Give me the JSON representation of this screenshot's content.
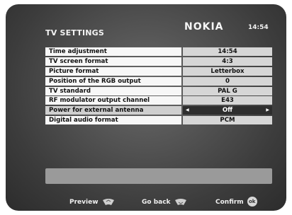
{
  "header": {
    "title": "TV SETTINGS",
    "brand": "NOKIA",
    "time": "14:54"
  },
  "settings": [
    {
      "label": "Time adjustment",
      "value": "14:54"
    },
    {
      "label": "TV screen format",
      "value": "4:3"
    },
    {
      "label": "Picture format",
      "value": "Letterbox"
    },
    {
      "label": "Position of the RGB output",
      "value": "0"
    },
    {
      "label": "TV standard",
      "value": "PAL G"
    },
    {
      "label": "RF modulator output channel",
      "value": "E43"
    },
    {
      "label": "Power for external antenna",
      "value": "Off"
    },
    {
      "label": "Digital audio format",
      "value": "PCM"
    }
  ],
  "footer": {
    "preview": "Preview",
    "go_back": "Go back",
    "confirm": "Confirm",
    "ok": "ok"
  },
  "icons": {
    "left_arrow": "left-arrow-icon",
    "right_arrow": "right-arrow-icon",
    "preview": "preview-remote-icon",
    "go_back": "back-remote-icon",
    "confirm": "ok-button-icon"
  },
  "colors": {
    "selected_value_bg": "#2e2e2e",
    "value_bg": "#d6d6d6",
    "label_bg": "#f7f7f7"
  }
}
